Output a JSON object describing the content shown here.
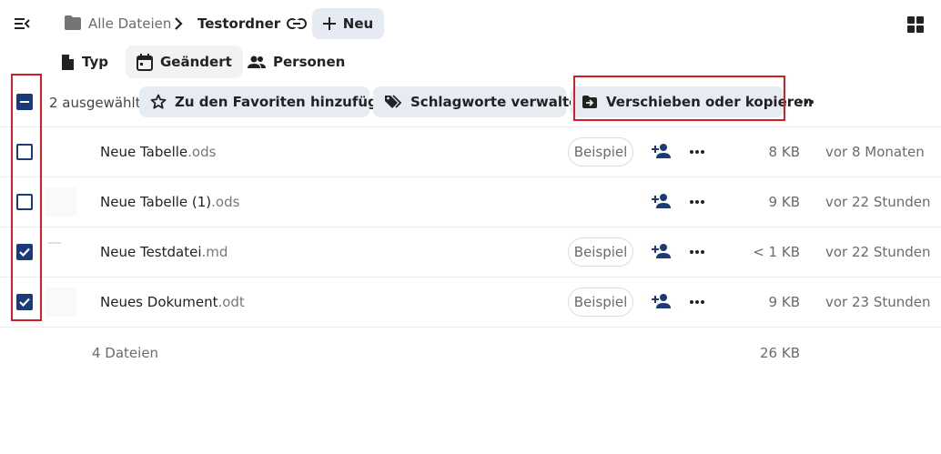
{
  "breadcrumb": {
    "root_label": "Alle Dateien",
    "current_label": "Testordner"
  },
  "toolbar": {
    "new_label": "Neu"
  },
  "filters": {
    "type_label": "Typ",
    "modified_label": "Geändert",
    "people_label": "Personen"
  },
  "selection": {
    "count_label": "2 ausgewählt",
    "favorite_label": "Zu den Favoriten hinzufügen",
    "tags_label": "Schlagworte verwalten",
    "move_label": "Verschieben oder kopieren"
  },
  "files": [
    {
      "base": "Neue Tabelle",
      "ext": ".ods",
      "tag": "Beispiel",
      "size": "8 KB",
      "modified": "vor 8 Monaten",
      "checked": false
    },
    {
      "base": "Neue Tabelle (1)",
      "ext": ".ods",
      "tag": "",
      "size": "9 KB",
      "modified": "vor 22 Stunden",
      "checked": false
    },
    {
      "base": "Neue Testdatei",
      "ext": ".md",
      "tag": "Beispiel",
      "size": "< 1 KB",
      "modified": "vor 22 Stunden",
      "checked": true
    },
    {
      "base": "Neues Dokument",
      "ext": ".odt",
      "tag": "Beispiel",
      "size": "9 KB",
      "modified": "vor 23 Stunden",
      "checked": true
    }
  ],
  "summary": {
    "count_label": "4 Dateien",
    "total_size": "26 KB"
  },
  "colors": {
    "accent": "#1a3a78",
    "highlight": "#d11f26",
    "pill_bg": "#e7ebf2"
  }
}
